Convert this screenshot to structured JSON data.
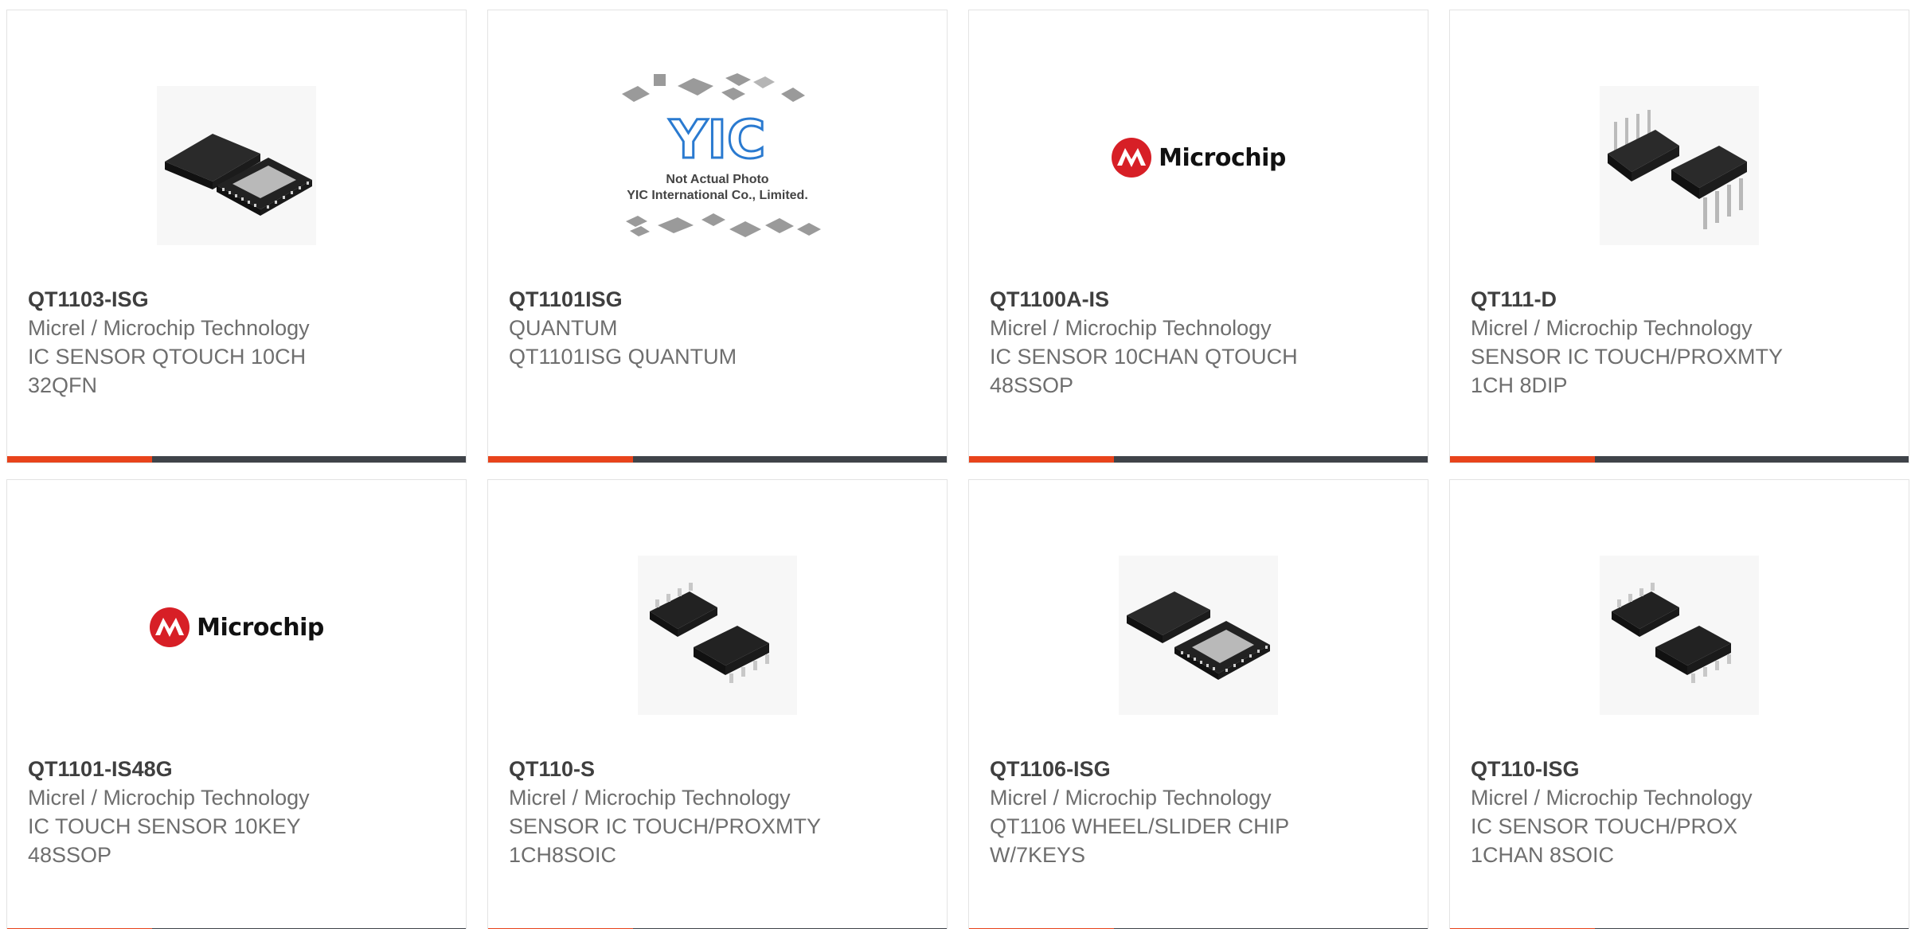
{
  "colors": {
    "accent": "#e8431b",
    "bar": "#3f4349",
    "part_number": "#3f3f3f",
    "text": "#6e6e6e",
    "microchip_red": "#d71f26"
  },
  "products": [
    {
      "part_number": "QT1103-ISG",
      "manufacturer": "Micrel / Microchip Technology",
      "description": "IC SENSOR QTOUCH 10CH 32QFN",
      "image": "qfn-chip-icon"
    },
    {
      "part_number": "QT1101ISG",
      "manufacturer": "QUANTUM",
      "description": "QT1101ISG QUANTUM",
      "image": "yic-placeholder-icon",
      "image_text": {
        "brand": "YIC",
        "line1": "Not Actual Photo",
        "line2": "YIC International Co., Limited."
      }
    },
    {
      "part_number": "QT1100A-IS",
      "manufacturer": "Micrel / Microchip Technology",
      "description": "IC SENSOR 10CHAN QTOUCH 48SSOP",
      "image": "microchip-logo",
      "logo_text": "Microchip"
    },
    {
      "part_number": "QT111-D",
      "manufacturer": "Micrel / Microchip Technology",
      "description": "SENSOR IC TOUCH/PROXMTY 1CH 8DIP",
      "image": "dip-chip-icon"
    },
    {
      "part_number": "QT1101-IS48G",
      "manufacturer": "Micrel / Microchip Technology",
      "description": "IC TOUCH SENSOR 10KEY 48SSOP",
      "image": "microchip-logo",
      "logo_text": "Microchip"
    },
    {
      "part_number": "QT110-S",
      "manufacturer": "Micrel / Microchip Technology",
      "description": "SENSOR IC TOUCH/PROXMTY 1CH8SOIC",
      "image": "soic-chip-icon"
    },
    {
      "part_number": "QT1106-ISG",
      "manufacturer": "Micrel / Microchip Technology",
      "description": "QT1106 WHEEL/SLIDER CHIP W/7KEYS",
      "image": "qfn-chip-icon"
    },
    {
      "part_number": "QT110-ISG",
      "manufacturer": "Micrel / Microchip Technology",
      "description": "IC SENSOR TOUCH/PROX 1CHAN 8SOIC",
      "image": "soic-chip-icon"
    }
  ]
}
